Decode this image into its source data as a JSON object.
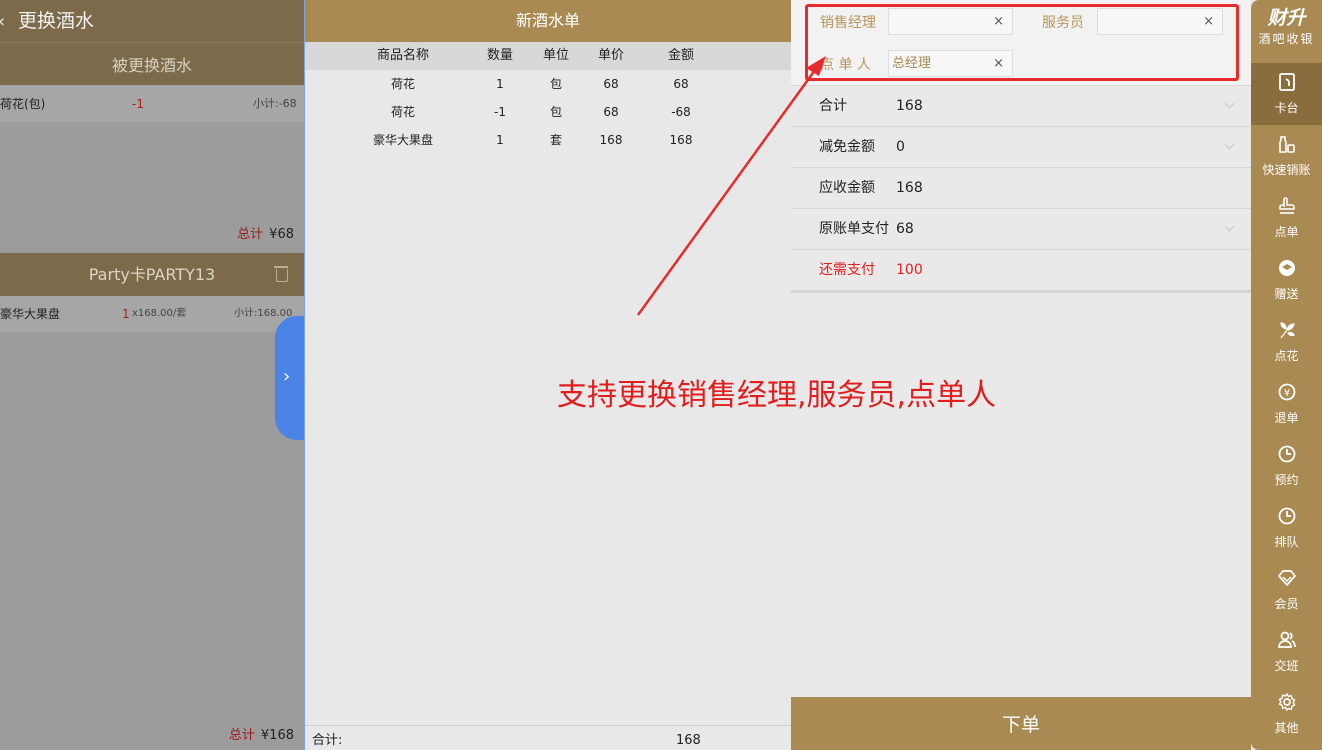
{
  "left_panel": {
    "title": "更换酒水",
    "replaced_header": "被更换酒水",
    "replaced_items": [
      {
        "name": "荷花(包)",
        "qty": "-1",
        "subtotal": "小计:-68"
      }
    ],
    "replaced_total_label": "总计",
    "replaced_total_value": "¥68",
    "card_header": "Party卡PARTY13",
    "card_items": [
      {
        "name": "豪华大果盘",
        "qty": "1",
        "price": "x168.00/套",
        "subtotal": "小计:168.00"
      }
    ],
    "card_total_label": "总计",
    "card_total_value": "¥168"
  },
  "middle_panel": {
    "title": "新酒水单",
    "columns": [
      "商品名称",
      "数量",
      "单位",
      "单价",
      "金额"
    ],
    "rows": [
      [
        "荷花",
        "1",
        "包",
        "68",
        "68"
      ],
      [
        "荷花",
        "-1",
        "包",
        "68",
        "-68"
      ],
      [
        "豪华大果盘",
        "1",
        "套",
        "168",
        "168"
      ]
    ],
    "footer_label": "合计:",
    "footer_value": "168"
  },
  "right_panel": {
    "staff": {
      "sales_manager_label": "销售经理",
      "sales_manager_value": "",
      "waiter_label": "服务员",
      "waiter_value": "",
      "orderer_label": "点 单 人",
      "orderer_value": "总经理",
      "clear_glyph": "×"
    },
    "summary": [
      {
        "label": "合计",
        "value": "168",
        "dropdown": true,
        "highlight": false
      },
      {
        "label": "减免金额",
        "value": "0",
        "dropdown": true,
        "highlight": false
      },
      {
        "label": "应收金额",
        "value": "168",
        "dropdown": false,
        "highlight": false
      },
      {
        "label": "原账单支付",
        "value": "68",
        "dropdown": true,
        "highlight": false
      },
      {
        "label": "还需支付",
        "value": "100",
        "dropdown": false,
        "highlight": true
      }
    ],
    "submit_label": "下单"
  },
  "annotation": {
    "text": "支持更换销售经理,服务员,点单人",
    "color": "#e01e1e"
  },
  "nav": {
    "brand_title": "财升",
    "brand_subtitle": "酒吧收银",
    "items": [
      {
        "label": "卡台",
        "icon": "door-icon",
        "active": true
      },
      {
        "label": "快速销账",
        "icon": "bottles-icon",
        "active": false
      },
      {
        "label": "点单",
        "icon": "hand-pointer-icon",
        "active": false
      },
      {
        "label": "赠送",
        "icon": "gift-icon",
        "active": false
      },
      {
        "label": "点花",
        "icon": "flower-icon",
        "active": false
      },
      {
        "label": "退单",
        "icon": "refund-icon",
        "active": false
      },
      {
        "label": "预约",
        "icon": "clock-icon",
        "active": false
      },
      {
        "label": "排队",
        "icon": "queue-clock-icon",
        "active": false
      },
      {
        "label": "会员",
        "icon": "diamond-icon",
        "active": false
      },
      {
        "label": "交班",
        "icon": "users-icon",
        "active": false
      },
      {
        "label": "其他",
        "icon": "gear-icon",
        "active": false
      }
    ]
  },
  "colors": {
    "gold": "#a88a52",
    "accent_red": "#e02020",
    "drawer_blue": "#4b84e6"
  }
}
